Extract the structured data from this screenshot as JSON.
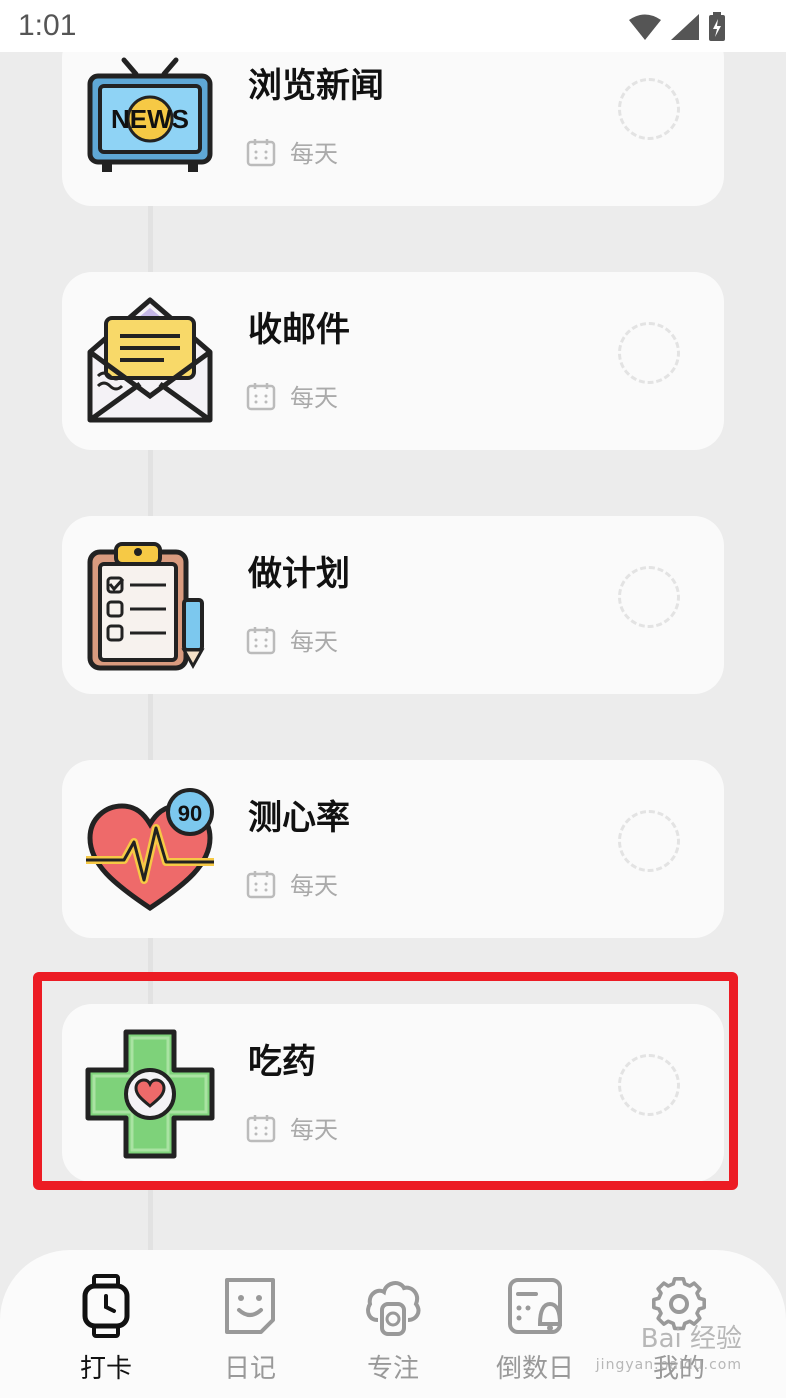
{
  "status_bar": {
    "time": "1:01"
  },
  "habits": [
    {
      "title": "浏览新闻",
      "frequency": "每天",
      "icon": "news-tv-icon"
    },
    {
      "title": "收邮件",
      "frequency": "每天",
      "icon": "mail-envelope-icon"
    },
    {
      "title": "做计划",
      "frequency": "每天",
      "icon": "clipboard-plan-icon"
    },
    {
      "title": "测心率",
      "frequency": "每天",
      "icon": "heart-rate-icon"
    },
    {
      "title": "吃药",
      "frequency": "每天",
      "icon": "medicine-cross-icon"
    }
  ],
  "highlight_color": "#ec1c24",
  "nav": [
    {
      "label": "打卡",
      "icon": "watch-icon",
      "active": true
    },
    {
      "label": "日记",
      "icon": "smile-note-icon",
      "active": false
    },
    {
      "label": "专注",
      "icon": "focus-timer-icon",
      "active": false
    },
    {
      "label": "倒数日",
      "icon": "countdown-calendar-icon",
      "active": false
    },
    {
      "label": "我的",
      "icon": "gear-icon",
      "active": false
    }
  ],
  "watermark": {
    "brand": "Bai 经验",
    "url": "jingyan.baidu.com"
  }
}
